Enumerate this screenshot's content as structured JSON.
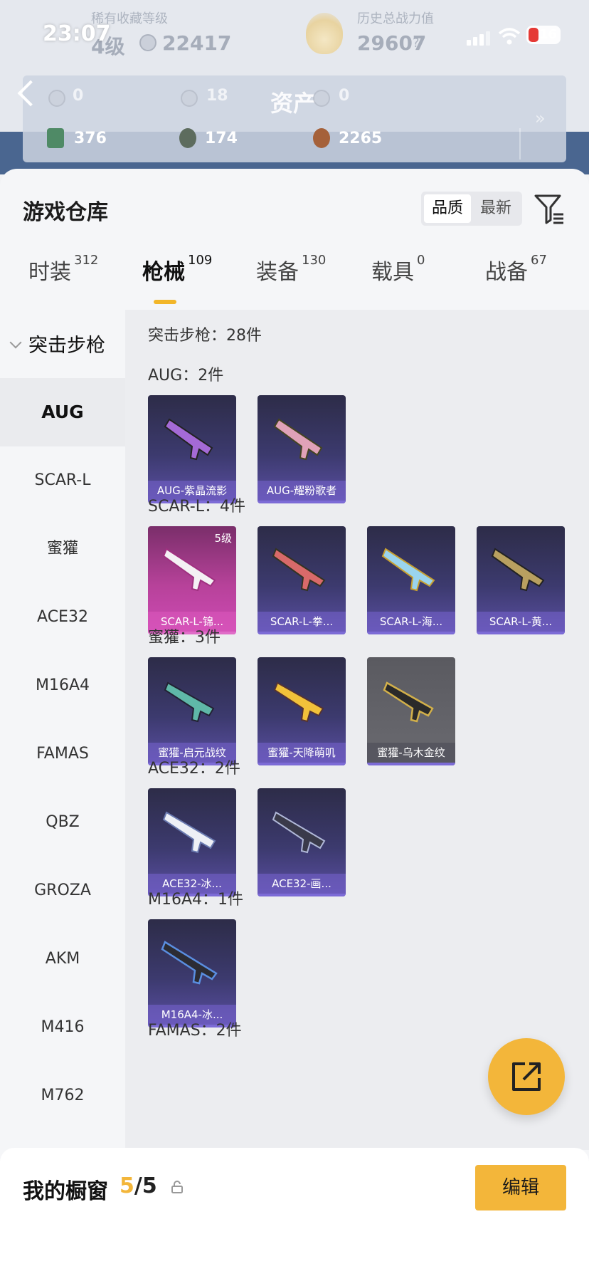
{
  "status_bar": {
    "time": "23:07",
    "battery": "16"
  },
  "header": {
    "title": "资产",
    "faint_left_label": "稀有收藏等级",
    "faint_level": "4级",
    "faint_points": "22417",
    "faint_right_label": "历史总战力值",
    "faint_power": "29607",
    "faint_q": "?",
    "faint_row": [
      "0",
      "18",
      "0"
    ],
    "resources": [
      "376",
      "174",
      "2265"
    ],
    "more": "»"
  },
  "warehouse": {
    "title": "游戏仓库",
    "sort": {
      "quality": "品质",
      "newest": "最新"
    },
    "tabs": [
      {
        "label": "时装",
        "count": "312"
      },
      {
        "label": "枪械",
        "count": "109"
      },
      {
        "label": "装备",
        "count": "130"
      },
      {
        "label": "载具",
        "count": "0"
      },
      {
        "label": "战备",
        "count": "67"
      }
    ],
    "sidebar": {
      "header": "突击步枪",
      "items": [
        "AUG",
        "SCAR-L",
        "蜜獾",
        "ACE32",
        "M16A4",
        "FAMAS",
        "QBZ",
        "GROZA",
        "AKM",
        "M416",
        "M762"
      ]
    },
    "category_total": "突击步枪：28件",
    "sections": [
      {
        "label": "AUG：2件",
        "items": [
          {
            "name": "AUG-紫晶流影",
            "style": "purple"
          },
          {
            "name": "AUG-耀粉歌者",
            "style": "purple"
          }
        ]
      },
      {
        "label": "SCAR-L：4件",
        "items": [
          {
            "name": "SCAR-L-锦...",
            "style": "pink",
            "level": "5级"
          },
          {
            "name": "SCAR-L-拳...",
            "style": "purple"
          },
          {
            "name": "SCAR-L-海...",
            "style": "purple"
          },
          {
            "name": "SCAR-L-黄...",
            "style": "purple"
          }
        ]
      },
      {
        "label": "蜜獾：3件",
        "items": [
          {
            "name": "蜜獾-启元战纹",
            "style": "purple"
          },
          {
            "name": "蜜獾-天降萌叽",
            "style": "purple"
          },
          {
            "name": "蜜獾-乌木金纹",
            "style": "gray"
          }
        ]
      },
      {
        "label": "ACE32：2件",
        "items": [
          {
            "name": "ACE32-冰...",
            "style": "purple"
          },
          {
            "name": "ACE32-画...",
            "style": "purple"
          }
        ]
      },
      {
        "label": "M16A4：1件",
        "items": [
          {
            "name": "M16A4-冰...",
            "style": "purple"
          }
        ]
      },
      {
        "label": "FAMAS：2件",
        "items": []
      }
    ]
  },
  "showcase": {
    "label": "我的橱窗",
    "count_used": "5",
    "count_sep_total": "/5",
    "edit": "编辑"
  },
  "colors": {
    "accent": "#f3b63a",
    "card_purple": "#3c3a6e",
    "card_pink": "#b7429a"
  }
}
